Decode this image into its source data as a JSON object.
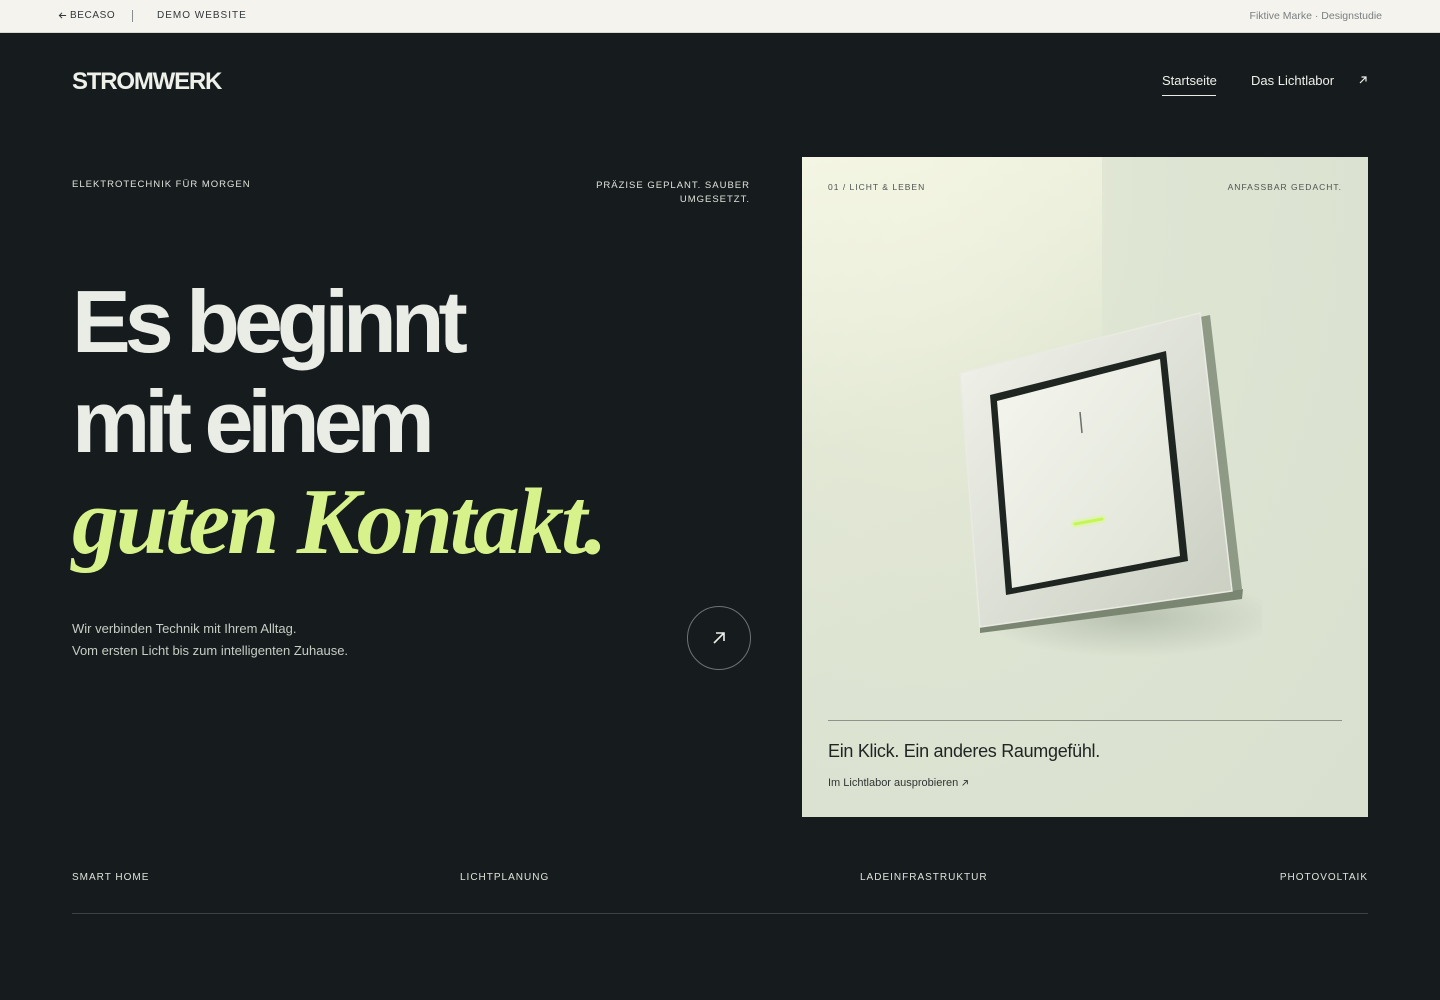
{
  "topbar": {
    "back_label": "BECASO",
    "demo_label": "DEMO WEBSITE",
    "note": "Fiktive Marke · Designstudie"
  },
  "header": {
    "logo": "STROMWERK",
    "nav": [
      {
        "label": "Startseite",
        "active": true
      },
      {
        "label": "Das Lichtlabor",
        "active": false
      }
    ]
  },
  "hero": {
    "eyebrow_left": "ELEKTROTECHNIK FÜR MORGEN",
    "eyebrow_right_1": "PRÄZISE GEPLANT. SAUBER",
    "eyebrow_right_2": "UMGESETZT.",
    "headline_line1": "Es beginnt",
    "headline_line2": "mit einem",
    "headline_accent": "guten Kontakt.",
    "lead_line1": "Wir verbinden Technik mit Ihrem Alltag.",
    "lead_line2": "Vom ersten Licht bis zum intelligenten Zuhause."
  },
  "card": {
    "tag_left": "01 / LICHT & LEBEN",
    "tag_right": "ANFASSBAR GEDACHT.",
    "title": "Ein Klick. Ein anderes Raumgefühl.",
    "link": "Im Lichtlabor ausprobieren"
  },
  "services": [
    "SMART HOME",
    "LICHTPLANUNG",
    "LADEINFRASTRUKTUR",
    "PHOTOVOLTAIK"
  ],
  "colors": {
    "background": "#161b1e",
    "accent": "#d7f28a",
    "card": "#dfe5d3",
    "topbar": "#f4f3ee"
  }
}
